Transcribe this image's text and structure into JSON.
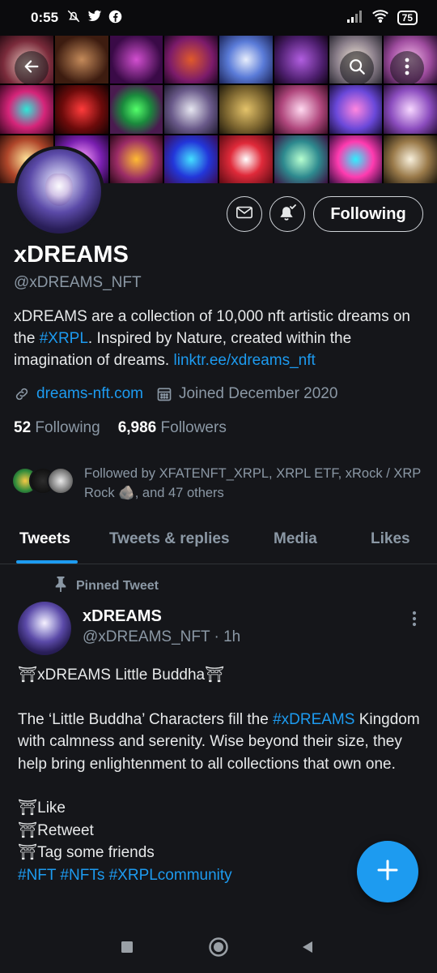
{
  "status_bar": {
    "time": "0:55",
    "battery": "75",
    "icons": [
      "mute-bell-icon",
      "twitter-icon",
      "facebook-icon",
      "signal-icon",
      "wifi-icon",
      "battery-icon"
    ]
  },
  "profile": {
    "display_name": "xDREAMS",
    "handle": "@xDREAMS_NFT",
    "bio_part1": "xDREAMS are a collection of 10,000 nft artistic dreams on the ",
    "bio_hashtag": "#XRPL",
    "bio_part2": ". Inspired by Nature, created within the imagination of dreams. ",
    "bio_link": "linktr.ee/xdreams_nft",
    "website": "dreams-nft.com",
    "joined": "Joined December 2020",
    "following_count": "52",
    "following_label": "Following",
    "followers_count": "6,986",
    "followers_label": "Followers",
    "followed_by": "Followed by XFATENFT_XRPL, XRPL ETF, xRock / XRP Rock 🪨, and 47 others",
    "follow_button": "Following"
  },
  "tabs": [
    {
      "label": "Tweets",
      "active": true
    },
    {
      "label": "Tweets & replies",
      "active": false
    },
    {
      "label": "Media",
      "active": false
    },
    {
      "label": "Likes",
      "active": false
    }
  ],
  "tweet": {
    "pinned_label": "Pinned Tweet",
    "author": "xDREAMS",
    "handle_time": "@xDREAMS_NFT · 1h",
    "title": "⛩xDREAMS Little Buddha⛩",
    "para_start": "The ‘Little Buddha’ Characters fill the ",
    "para_hashtag": "#xDREAMS",
    "para_end": " Kingdom with calmness and serenity. Wise beyond their size, they help bring enlightenment to all collections that own one.",
    "cta1": "⛩Like",
    "cta2": "⛩Retweet",
    "cta3": "⛩Tag some friends",
    "hashtags": "#NFT #NFTs #XRPLcommunity"
  },
  "colors": {
    "accent": "#1d9bf0",
    "background": "#15161a",
    "muted": "#8b98a5"
  }
}
